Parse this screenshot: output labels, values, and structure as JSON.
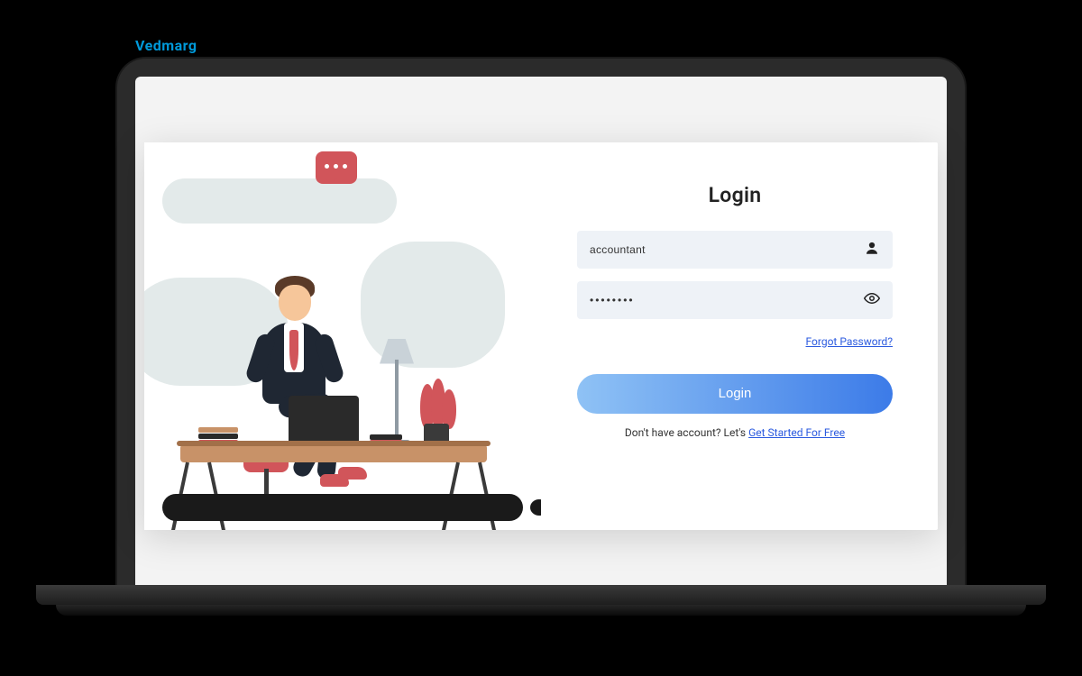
{
  "login": {
    "title": "Login",
    "username_value": "accountant",
    "password_value": "••••••••",
    "forgot_label": "Forgot Password?",
    "button_label": "Login",
    "signup_prefix": "Don't have account? Let's ",
    "signup_link": "Get Started For Free"
  },
  "brand": {
    "name": "Vedmarg"
  },
  "colors": {
    "accent": "#3c7be8",
    "link": "#2b5adf",
    "brand": "#0099d9",
    "illustration_accent": "#d1555a"
  }
}
